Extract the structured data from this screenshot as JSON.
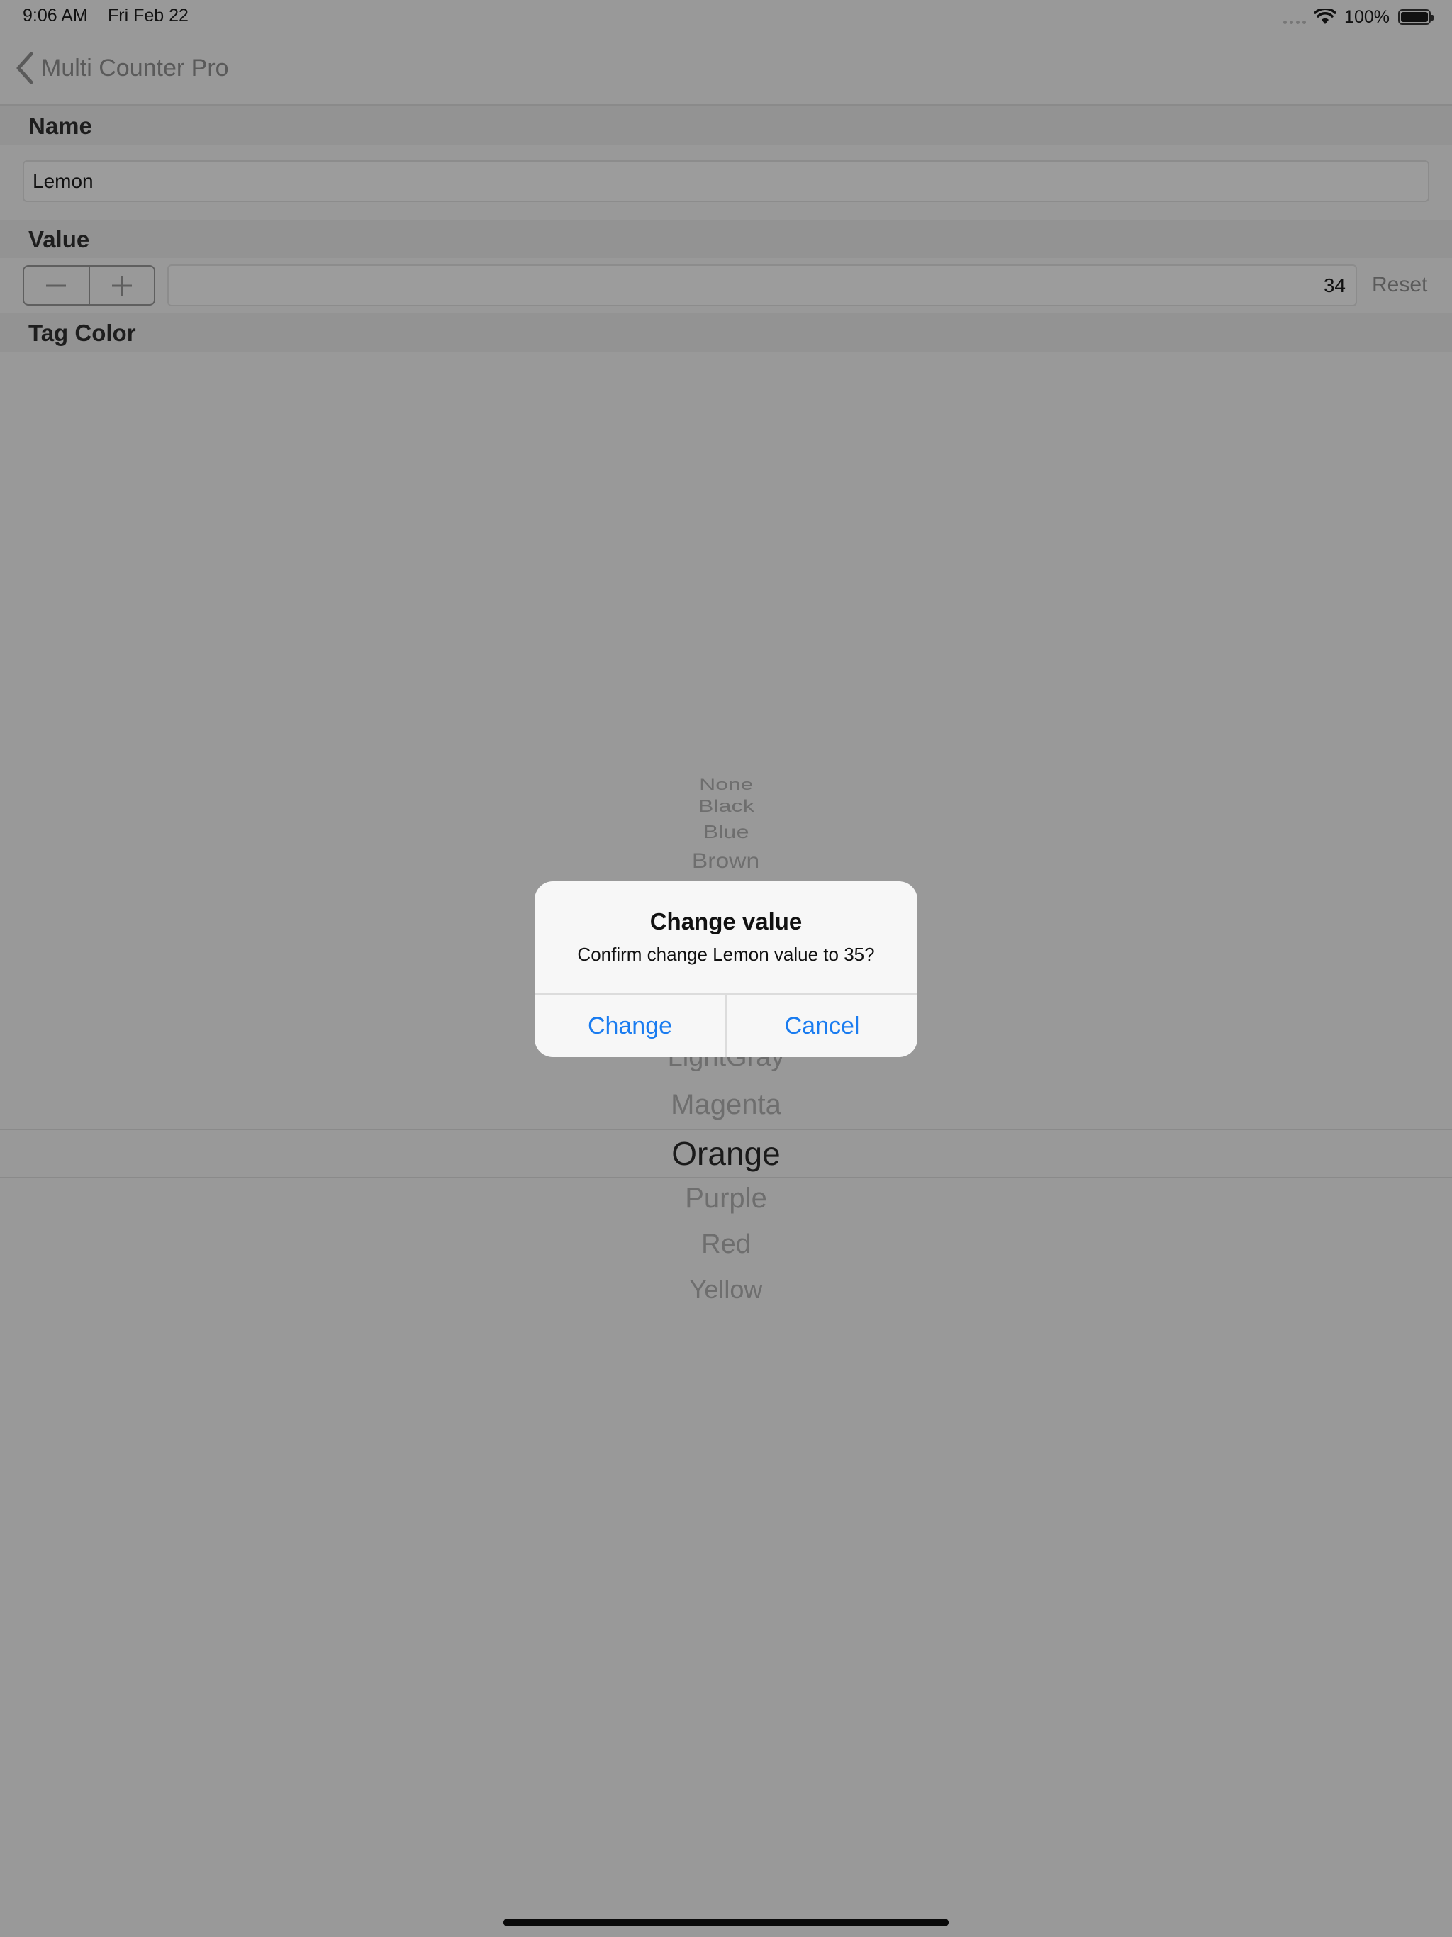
{
  "status_bar": {
    "time": "9:06 AM",
    "date": "Fri Feb 22",
    "battery": "100%",
    "icons": [
      "signal-dots-icon",
      "wifi-icon",
      "battery-icon"
    ]
  },
  "nav": {
    "back_label": "Multi Counter Pro",
    "back_icon": "chevron-left-icon"
  },
  "form": {
    "name_section": "Name",
    "name_value": "Lemon",
    "value_section": "Value",
    "value": "34",
    "decrement_icon": "minus-icon",
    "increment_icon": "plus-icon",
    "reset_label": "Reset",
    "tag_color_section": "Tag Color"
  },
  "picker": {
    "items": [
      "None",
      "Black",
      "Blue",
      "Brown",
      "LightGray",
      "Magenta",
      "Orange",
      "Purple",
      "Red",
      "Yellow"
    ],
    "selected": "Orange"
  },
  "alert": {
    "title": "Change value",
    "message": "Confirm change Lemon value to 35?",
    "change_label": "Change",
    "cancel_label": "Cancel",
    "accent_color": "#1a7cf0"
  },
  "colors": {
    "dimmed_background": "#999999",
    "alert_background": "#f7f7f7"
  }
}
